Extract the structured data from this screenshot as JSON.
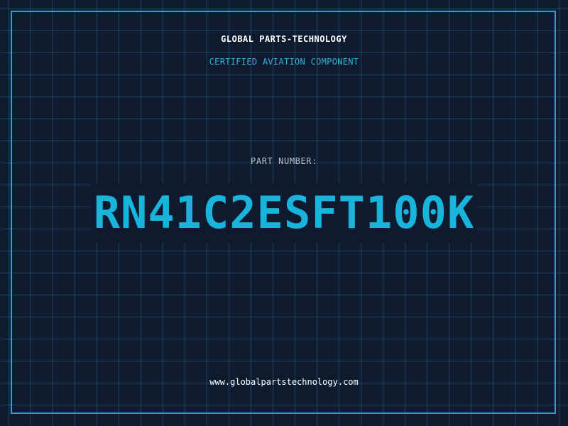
{
  "header": {
    "company": "GLOBAL PARTS-TECHNOLOGY",
    "subtitle": "CERTIFIED AVIATION COMPONENT"
  },
  "part": {
    "label": "PART NUMBER:",
    "number": "RN41C2ESFT100K"
  },
  "footer": {
    "website": "www.globalpartstechnology.com"
  },
  "colors": {
    "background": "#0f1a2e",
    "accent": "#18b4dc",
    "grid": "#266e87",
    "frame": "#1fa7cc"
  }
}
